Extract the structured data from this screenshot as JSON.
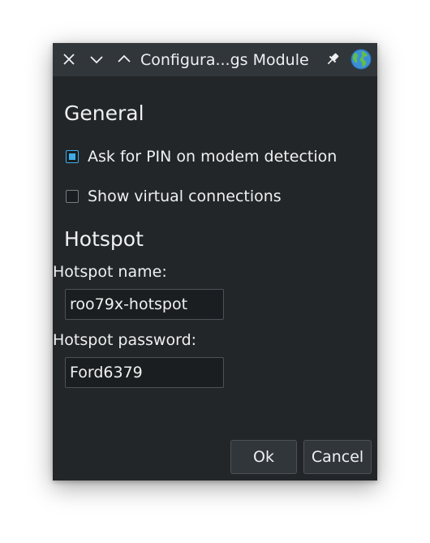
{
  "window": {
    "title": "Configura...gs Module",
    "buttons": {
      "close_icon": "close-icon",
      "minimize_icon": "chevron-down-icon",
      "maximize_icon": "chevron-up-icon",
      "pin_icon": "pin-icon",
      "app_icon": "globe-icon"
    }
  },
  "general": {
    "heading": "General",
    "ask_pin": {
      "label": "Ask for PIN on modem detection",
      "checked": true
    },
    "show_virtual": {
      "label": "Show virtual connections",
      "checked": false
    }
  },
  "hotspot": {
    "heading": "Hotspot",
    "name_label": "Hotspot name:",
    "name_value": "roo79x-hotspot",
    "password_label": "Hotspot password:",
    "password_value": "Ford6379"
  },
  "actions": {
    "ok_label": "Ok",
    "cancel_label": "Cancel"
  },
  "colors": {
    "window_bg": "#232629",
    "titlebar_bg": "#31363b",
    "accent": "#3daee9",
    "text": "#eff0f1"
  }
}
